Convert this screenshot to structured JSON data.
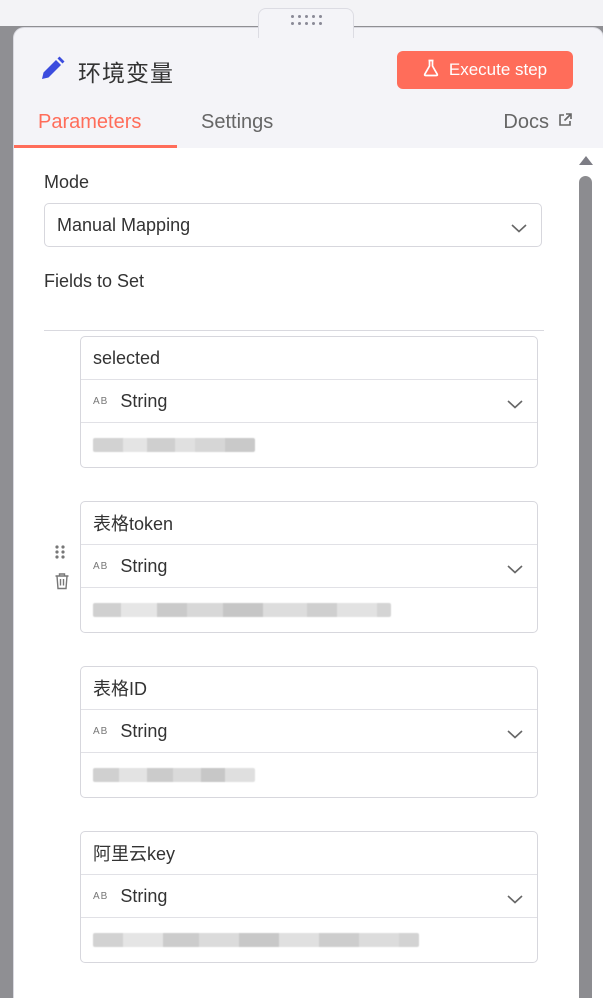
{
  "window": {
    "title": "环境变量",
    "execute_label": "Execute step"
  },
  "tabs": [
    {
      "label": "Parameters",
      "active": true
    },
    {
      "label": "Settings",
      "active": false
    }
  ],
  "docs_label": "Docs",
  "mode": {
    "label": "Mode",
    "value": "Manual Mapping"
  },
  "fields_label": "Fields to Set",
  "type_badge": "AB",
  "fields": [
    {
      "name": "selected",
      "type": "String"
    },
    {
      "name": "表格token",
      "type": "String"
    },
    {
      "name": "表格ID",
      "type": "String"
    },
    {
      "name": "阿里云key",
      "type": "String"
    }
  ],
  "colors": {
    "accent": "#ff6d5a",
    "pencil": "#3b4cde"
  }
}
